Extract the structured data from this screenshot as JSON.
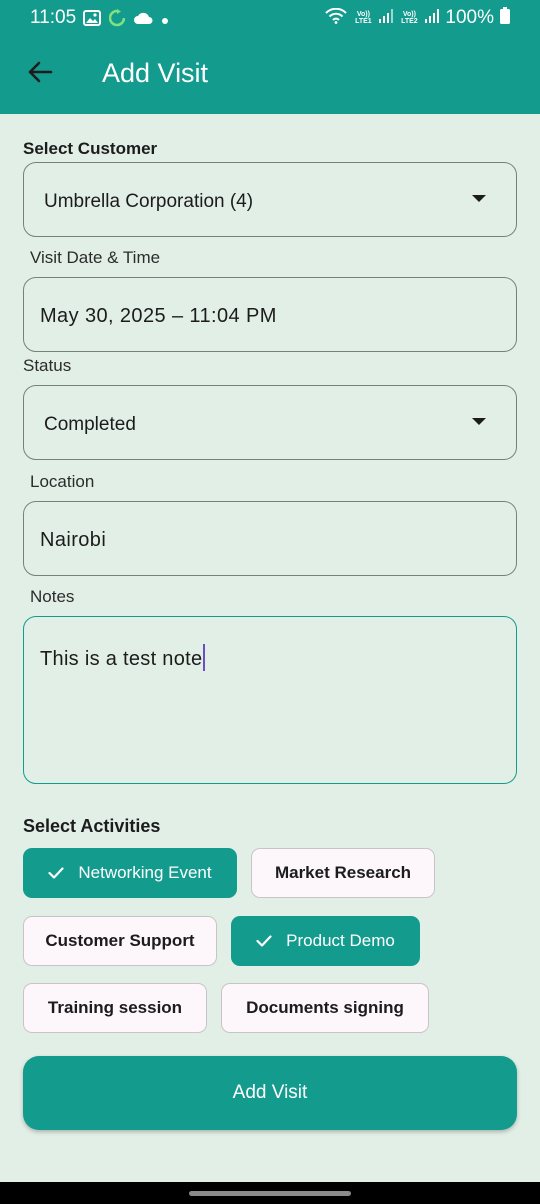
{
  "status_bar": {
    "time": "11:05",
    "battery": "100%",
    "sim1_label": "Vo)) LTE1",
    "sim2_label": "Vo)) LTE2",
    "icons": [
      "gallery-icon",
      "refresh-icon",
      "cloud-icon",
      "dot-icon",
      "wifi-icon",
      "signal-icon",
      "battery-icon"
    ]
  },
  "app_bar": {
    "title": "Add Visit",
    "back_icon": "arrow-left-icon"
  },
  "form": {
    "customer": {
      "label": "Select Customer",
      "value": "Umbrella Corporation (4)"
    },
    "visit_datetime": {
      "label": "Visit Date & Time",
      "value": "May 30, 2025 – 11:04 PM"
    },
    "status": {
      "label": "Status",
      "value": "Completed"
    },
    "location": {
      "label": "Location",
      "value": "Nairobi"
    },
    "notes": {
      "label": "Notes",
      "value": "This is a test note"
    }
  },
  "activities": {
    "label": "Select Activities",
    "items": [
      {
        "label": "Networking Event",
        "selected": true
      },
      {
        "label": "Market Research",
        "selected": false
      },
      {
        "label": "Customer Support",
        "selected": false
      },
      {
        "label": "Product Demo",
        "selected": true
      },
      {
        "label": "Training session",
        "selected": false
      },
      {
        "label": "Documents signing",
        "selected": false
      }
    ]
  },
  "submit_button": {
    "label": "Add Visit"
  },
  "colors": {
    "primary": "#139b8e",
    "background": "#e2efe7",
    "chip_unselected_bg": "#fdf7fb",
    "caret": "#6a4fc2"
  }
}
